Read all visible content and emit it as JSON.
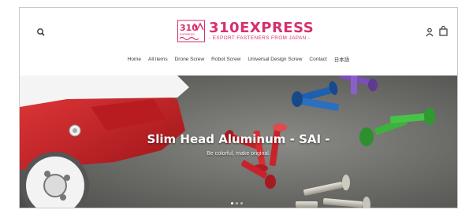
{
  "brand": {
    "name": "310EXPRESS",
    "tagline": "- EXPORT FASTENERS FROM JAPAN -",
    "mark_text": "310",
    "mark_subtext": "EXPRESS",
    "color": "#d6306e"
  },
  "header": {
    "search_icon": "search-icon",
    "account_icon": "user-icon",
    "cart_icon": "bag-icon"
  },
  "nav": {
    "items": [
      {
        "label": "Home"
      },
      {
        "label": "All items"
      },
      {
        "label": "Drone Screw"
      },
      {
        "label": "Robot Screw"
      },
      {
        "label": "Universal Design Screw"
      },
      {
        "label": "Contact"
      },
      {
        "label": "日本語"
      }
    ]
  },
  "hero": {
    "title": "Slim Head Aluminum - SAI -",
    "subtitle": "Be colorful, make original.",
    "slides_total": 3,
    "active_slide": 1
  },
  "colors": {
    "accent": "#d6306e",
    "red_part": "#c8232b",
    "blue_part": "#1f5fae",
    "green_part": "#3bb33b",
    "purple_part": "#7a4fb7",
    "background_surface": "#6b6b69"
  }
}
